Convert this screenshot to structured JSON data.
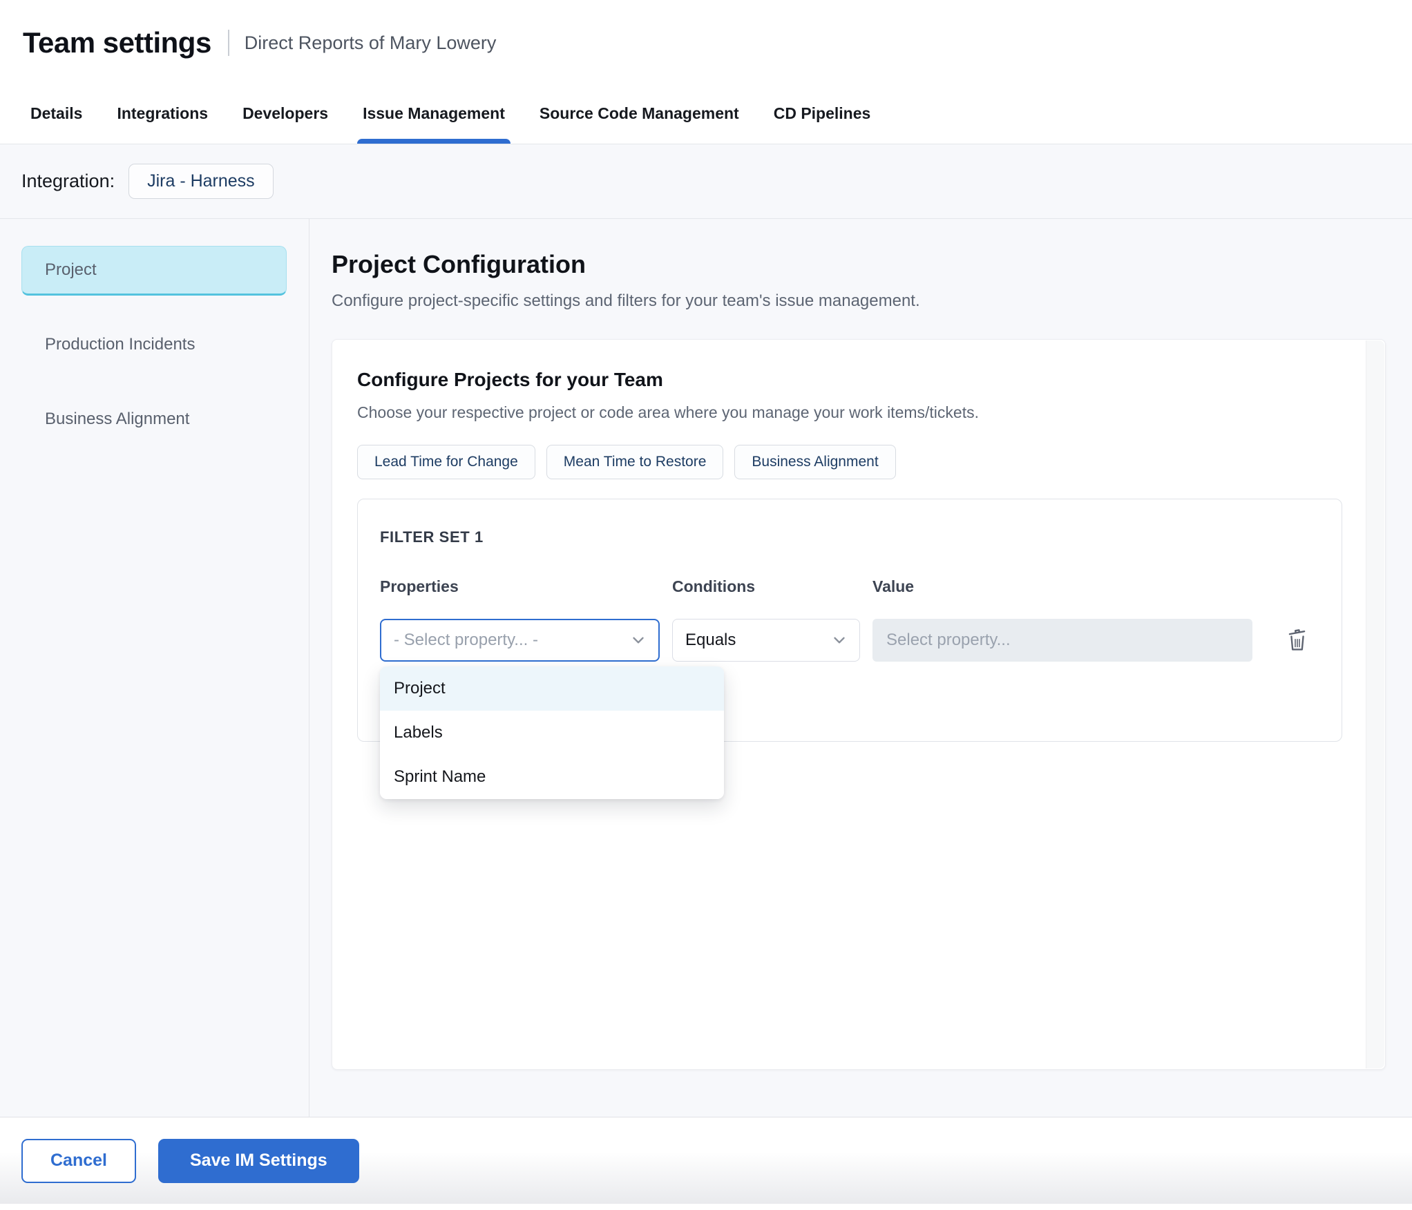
{
  "header": {
    "title": "Team settings",
    "subtitle": "Direct Reports of Mary Lowery"
  },
  "tabs": [
    {
      "label": "Details",
      "active": false
    },
    {
      "label": "Integrations",
      "active": false
    },
    {
      "label": "Developers",
      "active": false
    },
    {
      "label": "Issue Management",
      "active": true
    },
    {
      "label": "Source Code Management",
      "active": false
    },
    {
      "label": "CD Pipelines",
      "active": false
    }
  ],
  "integration": {
    "label": "Integration:",
    "value": "Jira - Harness"
  },
  "sidebar": {
    "items": [
      {
        "label": "Project",
        "selected": true
      },
      {
        "label": "Production Incidents",
        "selected": false
      },
      {
        "label": "Business Alignment",
        "selected": false
      }
    ]
  },
  "main": {
    "title": "Project Configuration",
    "description": "Configure project-specific settings and filters for your team's issue management.",
    "card": {
      "title": "Configure Projects for your Team",
      "description": "Choose your respective project or code area where you manage your work items/tickets.",
      "metric_tabs": [
        {
          "label": "Lead Time for Change"
        },
        {
          "label": "Mean Time to Restore"
        },
        {
          "label": "Business Alignment"
        }
      ],
      "filter_set": {
        "title": "FILTER SET 1",
        "columns": {
          "properties": "Properties",
          "conditions": "Conditions",
          "value": "Value"
        },
        "property_select": {
          "value": "- Select property... -"
        },
        "condition_select": {
          "value": "Equals"
        },
        "value_input": {
          "placeholder": "Select property..."
        },
        "property_options": [
          {
            "label": "Project",
            "highlighted": true
          },
          {
            "label": "Labels",
            "highlighted": false
          },
          {
            "label": "Sprint Name",
            "highlighted": false
          }
        ]
      }
    }
  },
  "footer": {
    "cancel": "Cancel",
    "save": "Save IM Settings"
  },
  "colors": {
    "accent_blue": "#2f6dd0",
    "sidebar_selected_bg": "#c9edf7",
    "dropdown_highlight": "#edf6fb",
    "chip_text": "#1d3c63",
    "page_bg": "#f7f8fb"
  }
}
